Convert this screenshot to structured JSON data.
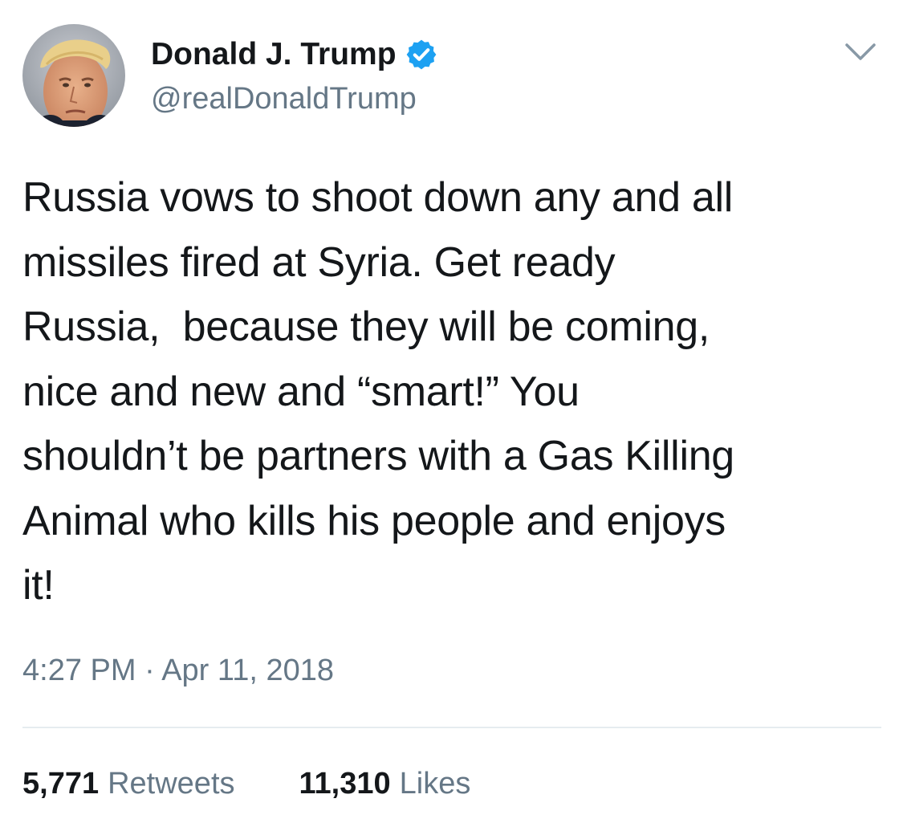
{
  "author": {
    "display_name": "Donald J. Trump",
    "handle": "@realDonaldTrump",
    "verified": true
  },
  "tweet": {
    "lines": [
      "Russia vows to shoot down any and all",
      "missiles fired at Syria. Get ready",
      "Russia,  because they will be coming,",
      "nice and new and “smart!” You",
      "shouldn’t be partners with a Gas Killing",
      "Animal who kills his people and enjoys",
      "it!"
    ],
    "timestamp": "4:27 PM · Apr 11, 2018"
  },
  "stats": {
    "retweets_count": "5,771",
    "retweets_label": "Retweets",
    "likes_count": "11,310",
    "likes_label": "Likes"
  },
  "icons": {
    "verified": "verified-badge-icon",
    "menu": "chevron-down-icon"
  },
  "colors": {
    "text": "#14171a",
    "secondary_text": "#657786",
    "verified_blue": "#1da1f2",
    "divider": "#e6ecf0"
  }
}
